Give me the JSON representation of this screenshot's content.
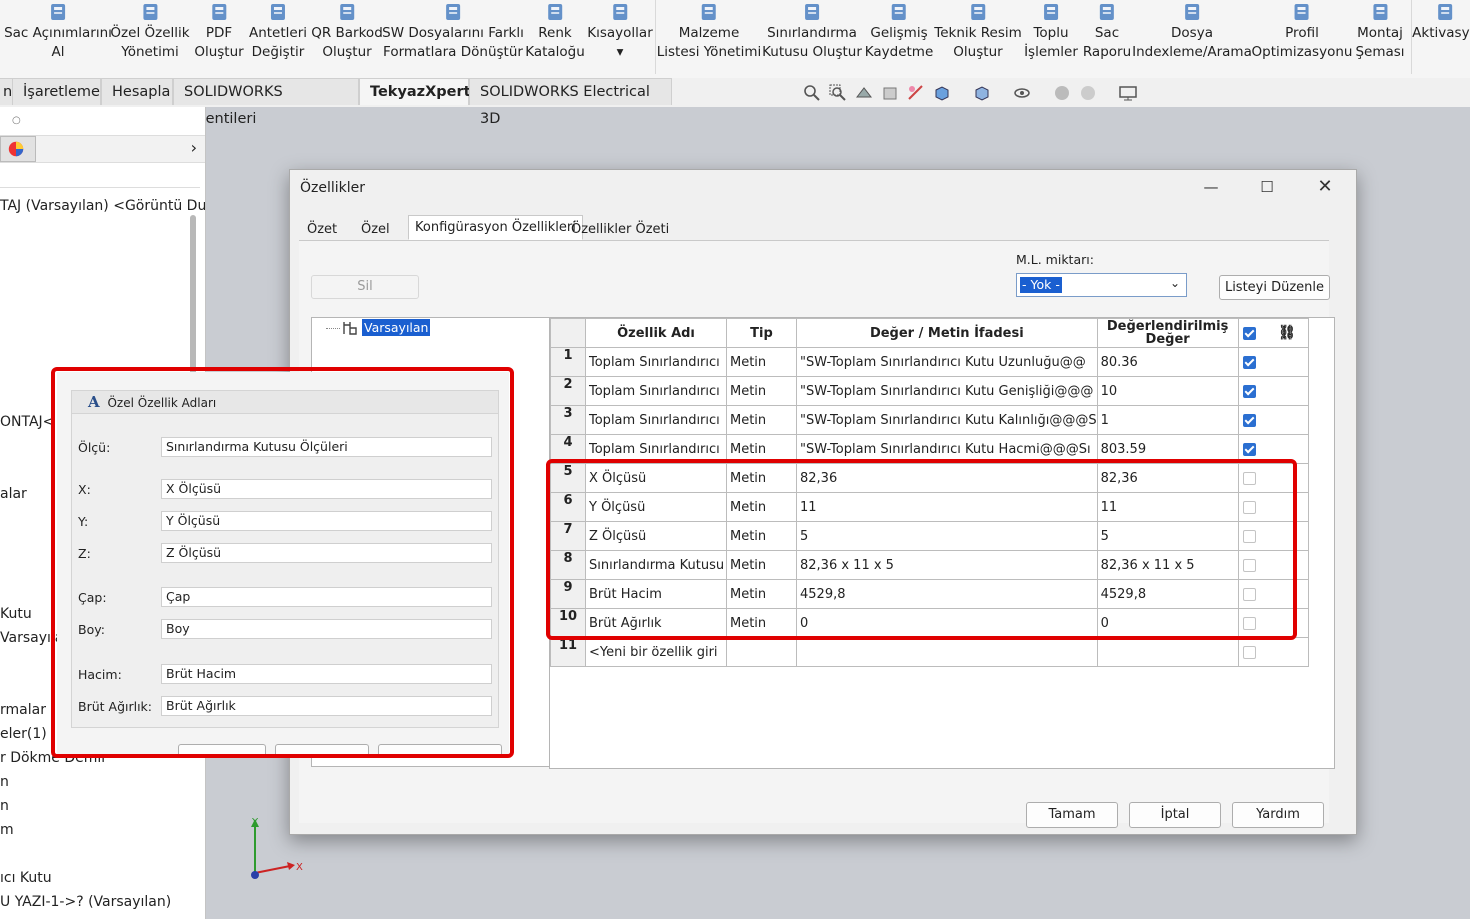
{
  "ribbon": {
    "items": [
      {
        "label1": "Sac Açınımlarını",
        "label2": "Al",
        "icon": "sheet-flat-icon",
        "color": "#4a7fc1"
      },
      {
        "label1": "Özel Özellik",
        "label2": "Yönetimi",
        "icon": "custom-property-icon",
        "color": "#4a7fc1"
      },
      {
        "label1": "PDF",
        "label2": "Oluştur",
        "icon": "pdf-file-icon",
        "color": "#4a7fc1"
      },
      {
        "label1": "Antetleri",
        "label2": "Değiştir",
        "icon": "titleblock-icon",
        "color": "#4a7fc1"
      },
      {
        "label1": "QR Barkod",
        "label2": "Oluştur",
        "icon": "qr-code-icon",
        "color": "#4a7fc1"
      },
      {
        "label1": "SW Dosyalarını Farklı",
        "label2": "Formatlara Dönüştür",
        "icon": "convert-file-icon",
        "color": "#4a7fc1"
      },
      {
        "label1": "Renk",
        "label2": "Kataloğu",
        "icon": "color-palette-icon",
        "color": "#4a7fc1"
      },
      {
        "label1": "Kısayollar",
        "label2": "▾",
        "icon": "shortcuts-icon",
        "color": "#4a7fc1"
      },
      {
        "label1": "Malzeme",
        "label2": "Listesi Yönetimi",
        "icon": "bom-table-icon",
        "color": "#4a7fc1"
      },
      {
        "label1": "Sınırlandırma",
        "label2": "Kutusu Oluştur",
        "icon": "bounding-box-icon",
        "color": "#4a7fc1"
      },
      {
        "label1": "Gelişmiş",
        "label2": "Kaydetme",
        "icon": "save-advanced-icon",
        "color": "#4a7fc1"
      },
      {
        "label1": "Teknik Resim",
        "label2": "Oluştur",
        "icon": "drawing-sheet-icon",
        "color": "#4a7fc1"
      },
      {
        "label1": "Toplu",
        "label2": "İşlemler",
        "icon": "batch-clipboard-icon",
        "color": "#4a7fc1"
      },
      {
        "label1": "Sac",
        "label2": "Raporu",
        "icon": "sheet-report-icon",
        "color": "#4a7fc1"
      },
      {
        "label1": "Dosya",
        "label2": "Indexleme/Arama",
        "icon": "file-search-icon",
        "color": "#4a7fc1"
      },
      {
        "label1": "Profil",
        "label2": "Optimizasyonu",
        "icon": "profile-optimize-icon",
        "color": "#4a7fc1"
      },
      {
        "label1": "Montaj",
        "label2": "Şeması",
        "icon": "assembly-tree-icon",
        "color": "#4a7fc1"
      },
      {
        "label1": "Aktivasyo",
        "label2": "",
        "icon": "lock-icon",
        "color": "#4a7fc1"
      }
    ]
  },
  "tabs": [
    {
      "label": "n"
    },
    {
      "label": "İşaretleme"
    },
    {
      "label": "Hesapla"
    },
    {
      "label": "SOLIDWORKS Eklentileri"
    },
    {
      "label": "TekyazXpert",
      "active": true
    },
    {
      "label": "SOLIDWORKS Electrical 3D"
    }
  ],
  "tree": {
    "items": [
      "TAJ (Varsayılan) <Görüntü Du",
      "ONTAJ<",
      "alar",
      "Kutu",
      "Varsayıla",
      "rmalar",
      "eler(1)",
      "r Dökme Demir",
      "n",
      "n",
      "m",
      "ıcı Kutu",
      "U YAZI-1->? (Varsayılan)"
    ]
  },
  "dialog": {
    "title": "Özellikler",
    "tabs": [
      "Özet",
      "Özel",
      "Konfigürasyon Özellikleri",
      "Özellikler Özeti"
    ],
    "delete_label": "Sil",
    "ml_label": "M.L. miktarı:",
    "ml_value": "- Yok -",
    "edit_list_label": "Listeyi Düzenle",
    "config_name": "Varsayılan",
    "headers": {
      "num": "",
      "name": "Özellik Adı",
      "type": "Tip",
      "value": "Değer / Metin İfadesi",
      "evaluated": "Değerlendirilmiş Değer"
    },
    "rows": [
      {
        "num": "1",
        "name": "Toplam Sınırlandırıcı",
        "type": "Metin",
        "value": "\"SW-Toplam Sınırlandırıcı Kutu Uzunluğu@@",
        "evaluated": "80.36",
        "checked": true
      },
      {
        "num": "2",
        "name": "Toplam Sınırlandırıcı",
        "type": "Metin",
        "value": "\"SW-Toplam Sınırlandırıcı Kutu Genişliği@@@",
        "evaluated": "10",
        "checked": true
      },
      {
        "num": "3",
        "name": "Toplam Sınırlandırıcı",
        "type": "Metin",
        "value": "\"SW-Toplam Sınırlandırıcı Kutu Kalınlığı@@@S",
        "evaluated": "1",
        "checked": true
      },
      {
        "num": "4",
        "name": "Toplam Sınırlandırıcı",
        "type": "Metin",
        "value": "\"SW-Toplam Sınırlandırıcı Kutu Hacmi@@@Sı",
        "evaluated": "803.59",
        "checked": true
      },
      {
        "num": "5",
        "name": "X Ölçüsü",
        "type": "Metin",
        "value": "82,36",
        "evaluated": "82,36",
        "checked": false
      },
      {
        "num": "6",
        "name": "Y Ölçüsü",
        "type": "Metin",
        "value": "11",
        "evaluated": "11",
        "checked": false
      },
      {
        "num": "7",
        "name": "Z Ölçüsü",
        "type": "Metin",
        "value": "5",
        "evaluated": "5",
        "checked": false
      },
      {
        "num": "8",
        "name": "Sınırlandırma Kutusu",
        "type": "Metin",
        "value": "82,36 x 11 x 5",
        "evaluated": "82,36 x 11 x 5",
        "checked": false
      },
      {
        "num": "9",
        "name": "Brüt Hacim",
        "type": "Metin",
        "value": "4529,8",
        "evaluated": "4529,8",
        "checked": false
      },
      {
        "num": "10",
        "name": "Brüt Ağırlık",
        "type": "Metin",
        "value": "0",
        "evaluated": "0",
        "checked": false
      },
      {
        "num": "11",
        "name": "<Yeni bir özellik giri",
        "type": "",
        "value": "",
        "evaluated": "",
        "checked": false
      }
    ],
    "ok_label": "Tamam",
    "cancel_label": "İptal",
    "help_label": "Yardım"
  },
  "popup": {
    "group_title": "Özel Özellik Adları",
    "fields": [
      {
        "label": "Ölçü:",
        "value": "Sınırlandırma Kutusu Ölçüleri"
      },
      {
        "label": "X:",
        "value": "X Ölçüsü"
      },
      {
        "label": "Y:",
        "value": "Y Ölçüsü"
      },
      {
        "label": "Z:",
        "value": "Z Ölçüsü"
      },
      {
        "label": "Çap:",
        "value": "Çap"
      },
      {
        "label": "Boy:",
        "value": "Boy"
      },
      {
        "label": "Hacim:",
        "value": "Brüt Hacim"
      },
      {
        "label": "Brüt Ağırlık:",
        "value": "Brüt Ağırlık"
      }
    ]
  },
  "colors": {
    "highlight": "#e00000",
    "selection": "#1a5fd0",
    "accent": "#4a7fc1"
  }
}
